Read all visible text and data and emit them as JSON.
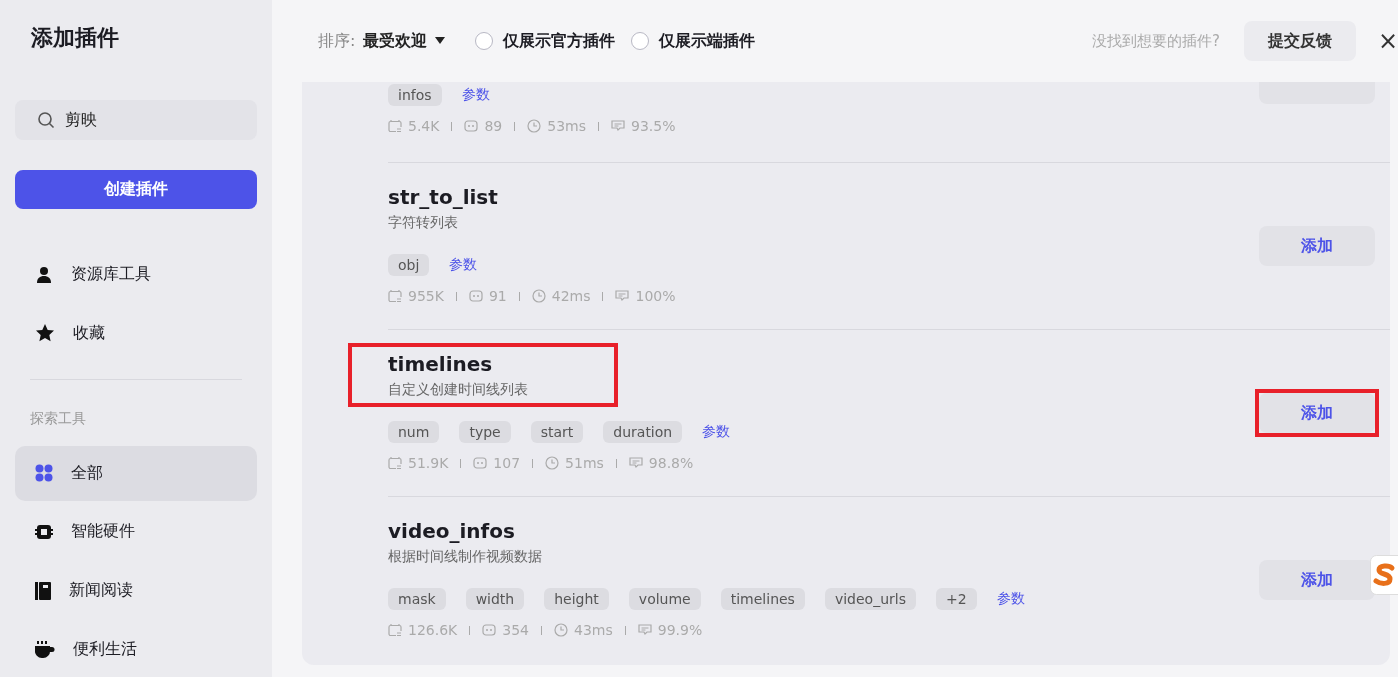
{
  "sidebar": {
    "title": "添加插件",
    "search": {
      "value": "剪映"
    },
    "create_button": "创建插件",
    "top_items": [
      {
        "label": "资源库工具",
        "selected": false
      },
      {
        "label": "收藏",
        "selected": false
      }
    ],
    "section_label": "探索工具",
    "categories": [
      {
        "label": "全部",
        "selected": true
      },
      {
        "label": "智能硬件",
        "selected": false
      },
      {
        "label": "新闻阅读",
        "selected": false
      },
      {
        "label": "便利生活",
        "selected": false
      }
    ]
  },
  "header": {
    "sort_label": "排序:",
    "sort_value": "最受欢迎",
    "filters": [
      {
        "label": "仅展示官方插件",
        "checked": false
      },
      {
        "label": "仅展示端插件",
        "checked": false
      }
    ],
    "feedback_prompt": "没找到想要的插件?",
    "feedback_button": "提交反馈",
    "close": "×"
  },
  "plugins": [
    {
      "kind": "partial",
      "params": [
        "infos"
      ],
      "params_link": "参数",
      "stats": [
        "5.4K",
        "89",
        "53ms",
        "93.5%"
      ],
      "highlight_add": false
    },
    {
      "kind": "full",
      "name": "str_to_list",
      "description": "字符转列表",
      "params": [
        "obj"
      ],
      "params_link": "参数",
      "stats": [
        "955K",
        "91",
        "42ms",
        "100%"
      ],
      "add_button": "添加",
      "highlight_info": false,
      "highlight_add": false
    },
    {
      "kind": "full",
      "name": "timelines",
      "description": "自定义创建时间线列表",
      "params": [
        "num",
        "type",
        "start",
        "duration"
      ],
      "params_link": "参数",
      "stats": [
        "51.9K",
        "107",
        "51ms",
        "98.8%"
      ],
      "add_button": "添加",
      "highlight_info": true,
      "highlight_add": true
    },
    {
      "kind": "full",
      "name": "video_infos",
      "description": "根据时间线制作视频数据",
      "params": [
        "mask",
        "width",
        "height",
        "volume",
        "timelines",
        "video_urls",
        "+2"
      ],
      "params_link": "参数",
      "stats": [
        "126.6K",
        "354",
        "43ms",
        "99.9%"
      ],
      "add_button": "添加",
      "highlight_info": false,
      "highlight_add": false
    }
  ]
}
